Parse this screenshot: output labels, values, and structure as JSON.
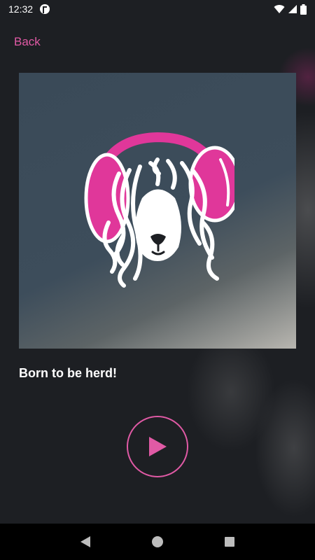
{
  "status_bar": {
    "time": "12:32",
    "icons": [
      "app-notification-icon",
      "wifi-icon",
      "signal-icon",
      "battery-icon"
    ]
  },
  "header": {
    "back_label": "Back"
  },
  "track": {
    "title": "Born to be herd!",
    "artwork": "lamb-with-headphones-logo"
  },
  "player": {
    "play_icon": "play-icon"
  },
  "colors": {
    "accent": "#e05aa5",
    "background": "#1d1f23",
    "artwork_bg": "#3d4d5b",
    "headphones": "#e0379a"
  },
  "nav_bar": {
    "icons": [
      "back-triangle-icon",
      "home-circle-icon",
      "recents-square-icon"
    ]
  }
}
